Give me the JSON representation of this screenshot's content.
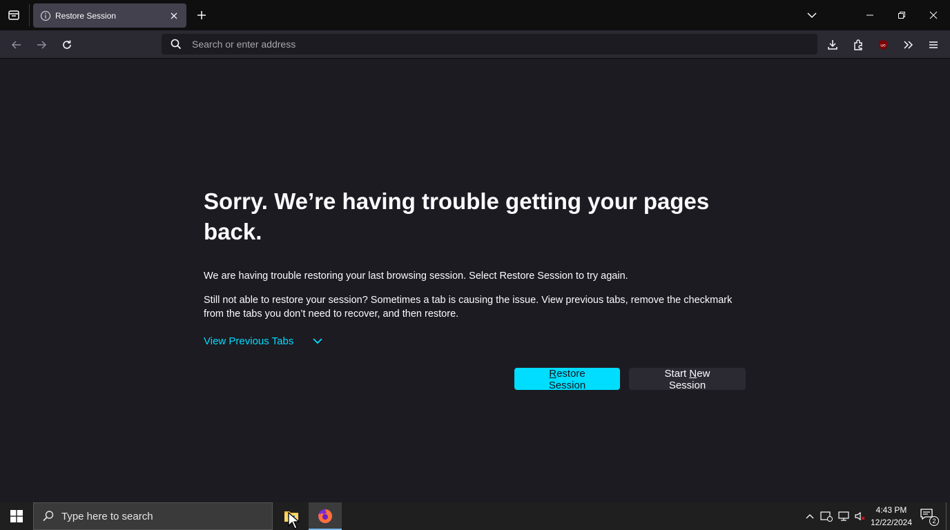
{
  "browser": {
    "tab": {
      "title": "Restore Session"
    },
    "urlbar": {
      "placeholder": "Search or enter address"
    }
  },
  "page": {
    "heading": "Sorry. We’re having trouble getting your pages back.",
    "paragraph1": "We are having trouble restoring your last browsing session. Select Restore Session to try again.",
    "paragraph2": "Still not able to restore your session? Sometimes a tab is causing the issue. View previous tabs, remove the checkmark from the tabs you don’t need to recover, and then restore.",
    "view_previous_tabs": "View Previous Tabs",
    "restore_btn": {
      "underlined": "R",
      "rest": "estore Session"
    },
    "new_session_btn": {
      "pre": "Start ",
      "underlined": "N",
      "rest": "ew Session"
    }
  },
  "taskbar": {
    "search_placeholder": "Type here to search",
    "time": "4:43 PM",
    "date": "12/22/2024",
    "notification_count": "2"
  },
  "colors": {
    "accent": "#00ddff",
    "content_bg": "#1c1b22",
    "toolbar_bg": "#2b2a33"
  }
}
